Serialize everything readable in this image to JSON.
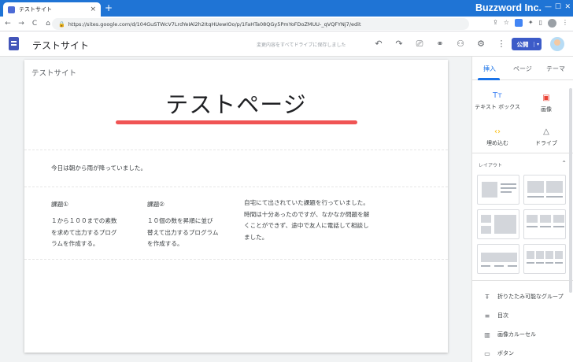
{
  "browser": {
    "tab_title": "テストサイト",
    "tab_close": "×",
    "new_tab": "+",
    "url": "https://sites.google.com/d/104GuSTWcV7LrdYeIAl2h2ItqHUewIOo/p/1FaHTa08QGy5PmYoFDoZMUU-_qVQFYNj7/edit",
    "brand": "Buzzword Inc.",
    "nav": {
      "back": "←",
      "forward": "→",
      "reload": "C",
      "home": "⌂"
    },
    "win_controls": {
      "minimize": "—",
      "maximize": "☐",
      "close": "✕"
    }
  },
  "sites_header": {
    "site_name": "テストサイト",
    "save_status": "変更内容をすべてドライブに保存しました",
    "publish_label": "公開",
    "publish_dropdown": "▾",
    "tools": [
      {
        "name": "undo-icon",
        "glyph": "↶"
      },
      {
        "name": "redo-icon",
        "glyph": "↷"
      },
      {
        "name": "preview-icon",
        "glyph": "⎚"
      },
      {
        "name": "link-icon",
        "glyph": "⚭"
      },
      {
        "name": "share-icon",
        "glyph": "⚇"
      },
      {
        "name": "settings-icon",
        "glyph": "⚙"
      },
      {
        "name": "more-icon",
        "glyph": "⋮"
      }
    ]
  },
  "page": {
    "site_name": "テストサイト",
    "title": "テストページ",
    "intro": "今日は朝から雨が降っていました。",
    "col1_heading": "課題①",
    "col1_lines": [
      "１から１００までの素数",
      "を求めて出力するプログ",
      "ラムを作成する。"
    ],
    "col2_heading": "課題②",
    "col2_lines": [
      "１０個の数を昇順に並び",
      "替えて出力するプログラム",
      "を作成する。"
    ],
    "col3_lines": [
      "自宅にて出されていた課題を行っていました。",
      "時間は十分あったのですが、なかなか問題を解",
      "くことができず、途中で友人に電話して相談し",
      "ました。"
    ],
    "accent_color": "#f05454"
  },
  "right_panel": {
    "tabs": [
      "挿入",
      "ページ",
      "テーマ"
    ],
    "insert_items": [
      {
        "icon_glyph": "Tт",
        "label": "テキスト ボックス",
        "color": "#4285f4"
      },
      {
        "icon_glyph": "▣",
        "label": "画像",
        "color": "#ea4335"
      },
      {
        "icon_glyph": "‹›",
        "label": "埋め込む",
        "color": "#fbbc04"
      },
      {
        "icon_glyph": "△",
        "label": "ドライブ",
        "color": "#5f6368"
      }
    ],
    "layout_header": "レイアウト",
    "layout_chevron": "⌃",
    "components": [
      {
        "icon_glyph": "Ŧ",
        "label": "折りたたみ可能なグループ"
      },
      {
        "icon_glyph": "≡",
        "label": "目次"
      },
      {
        "icon_glyph": "▥",
        "label": "画像カルーセル"
      },
      {
        "icon_glyph": "▭",
        "label": "ボタン"
      }
    ]
  }
}
